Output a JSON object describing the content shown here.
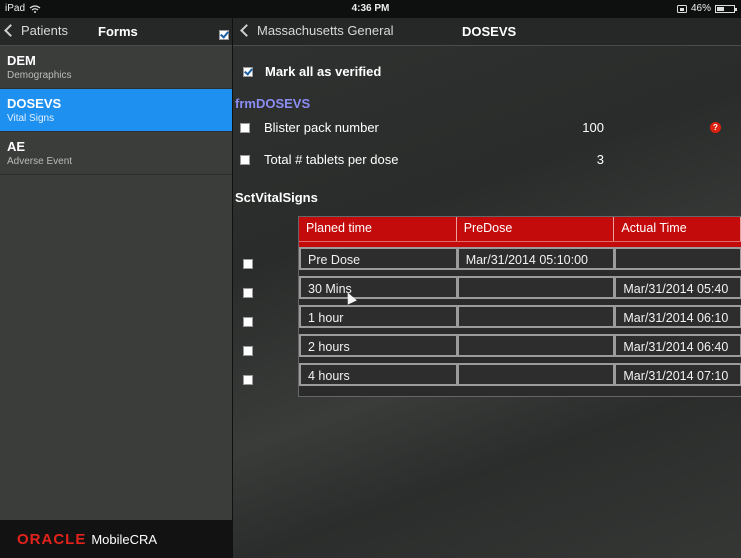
{
  "status_bar": {
    "device": "iPad",
    "time": "4:36 PM",
    "battery": "46%",
    "battery_level": 0.46
  },
  "left_nav": {
    "back_label": "Patients",
    "title": "Forms"
  },
  "forms": [
    {
      "code": "DEM",
      "desc": "Demographics",
      "selected": false
    },
    {
      "code": "DOSEVS",
      "desc": "Vital Signs",
      "selected": true
    },
    {
      "code": "AE",
      "desc": "Adverse Event",
      "selected": false
    }
  ],
  "footer": {
    "brand": "ORACLE",
    "product": "MobileCRA",
    "brand_color": "#e3231b"
  },
  "right_nav": {
    "back_label": "Massachusetts General",
    "title": "DOSEVS",
    "verified_checked": true
  },
  "mark_all": {
    "label": "Mark all as verified",
    "checked": true
  },
  "form_title": "frmDOSEVS",
  "fields": [
    {
      "label": "Blister pack number",
      "value": "100",
      "checked": false,
      "help": "?"
    },
    {
      "label": "Total # tablets per dose",
      "value": "3",
      "checked": false
    }
  ],
  "section_title": "SctVitalSigns",
  "table": {
    "headers": [
      "Planed time",
      "PreDose",
      "Actual Time"
    ],
    "header_color": "#c40b0b",
    "rows": [
      {
        "cells": [
          "Pre Dose",
          "Mar/31/2014 05:10:00",
          ""
        ],
        "checked": false
      },
      {
        "cells": [
          "30 Mins",
          "",
          "Mar/31/2014 05:40"
        ],
        "checked": false
      },
      {
        "cells": [
          "1 hour",
          "",
          "Mar/31/2014 06:10"
        ],
        "checked": false
      },
      {
        "cells": [
          "2 hours",
          "",
          "Mar/31/2014 06:40"
        ],
        "checked": false
      },
      {
        "cells": [
          "4 hours",
          "",
          "Mar/31/2014 07:10"
        ],
        "checked": false
      }
    ]
  },
  "accent_color": "#1e90f0"
}
